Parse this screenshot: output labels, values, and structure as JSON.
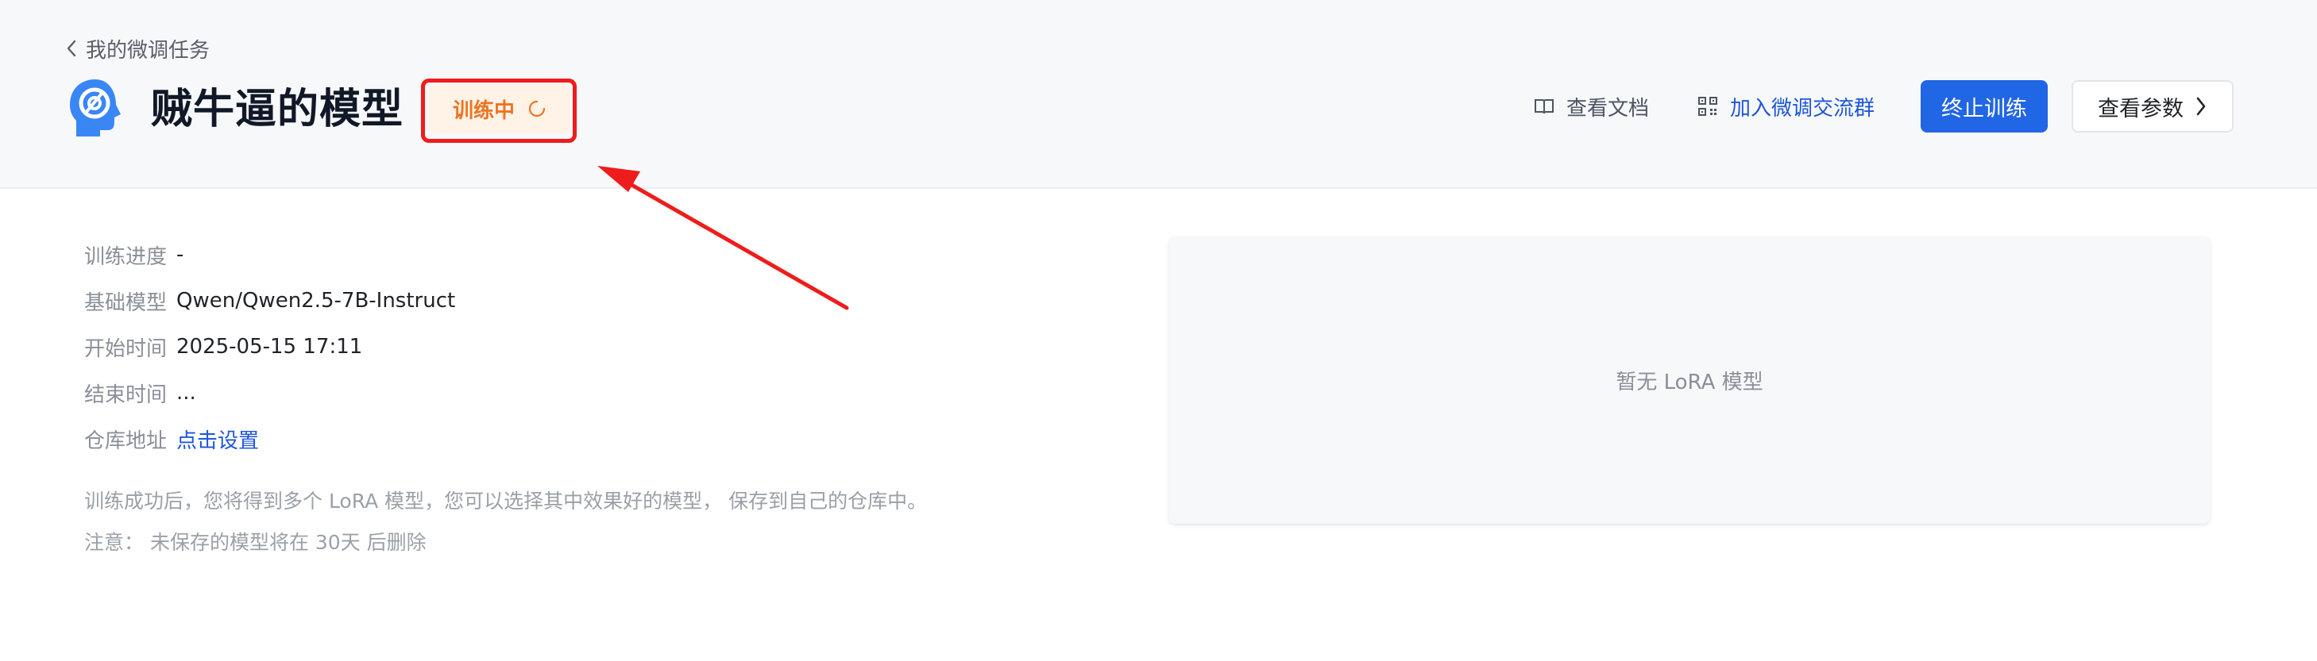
{
  "header": {
    "back_label": "我的微调任务",
    "title": "贼牛逼的模型",
    "status": "训练中",
    "docs_label": "查看文档",
    "group_label": "加入微调交流群",
    "stop_label": "终止训练",
    "params_label": "查看参数"
  },
  "info": {
    "rows": [
      {
        "label": "训练进度",
        "value": "-"
      },
      {
        "label": "基础模型",
        "value": "Qwen/Qwen2.5-7B-Instruct"
      },
      {
        "label": "开始时间",
        "value": "2025-05-15 17:11"
      },
      {
        "label": "结束时间",
        "value": "..."
      },
      {
        "label": "仓库地址",
        "value": "点击设置"
      }
    ],
    "note_1": "训练成功后，您将得到多个 LoRA 模型，您可以选择其中效果好的模型， 保存到自己的仓库中。",
    "note_2": "注意：  未保存的模型将在 30天 后删除"
  },
  "lora_panel": {
    "empty_text": "暂无 LoRA 模型"
  },
  "colors": {
    "accent": "#2166e4",
    "status": "#ee7421",
    "annotation": "#ee1c1c"
  },
  "icons": {
    "back": "chevron-left-icon",
    "logo": "ai-head-logo-icon",
    "status": "loading-spinner-icon",
    "docs": "book-icon",
    "group": "qr-code-icon",
    "params": "chevron-right-icon"
  }
}
